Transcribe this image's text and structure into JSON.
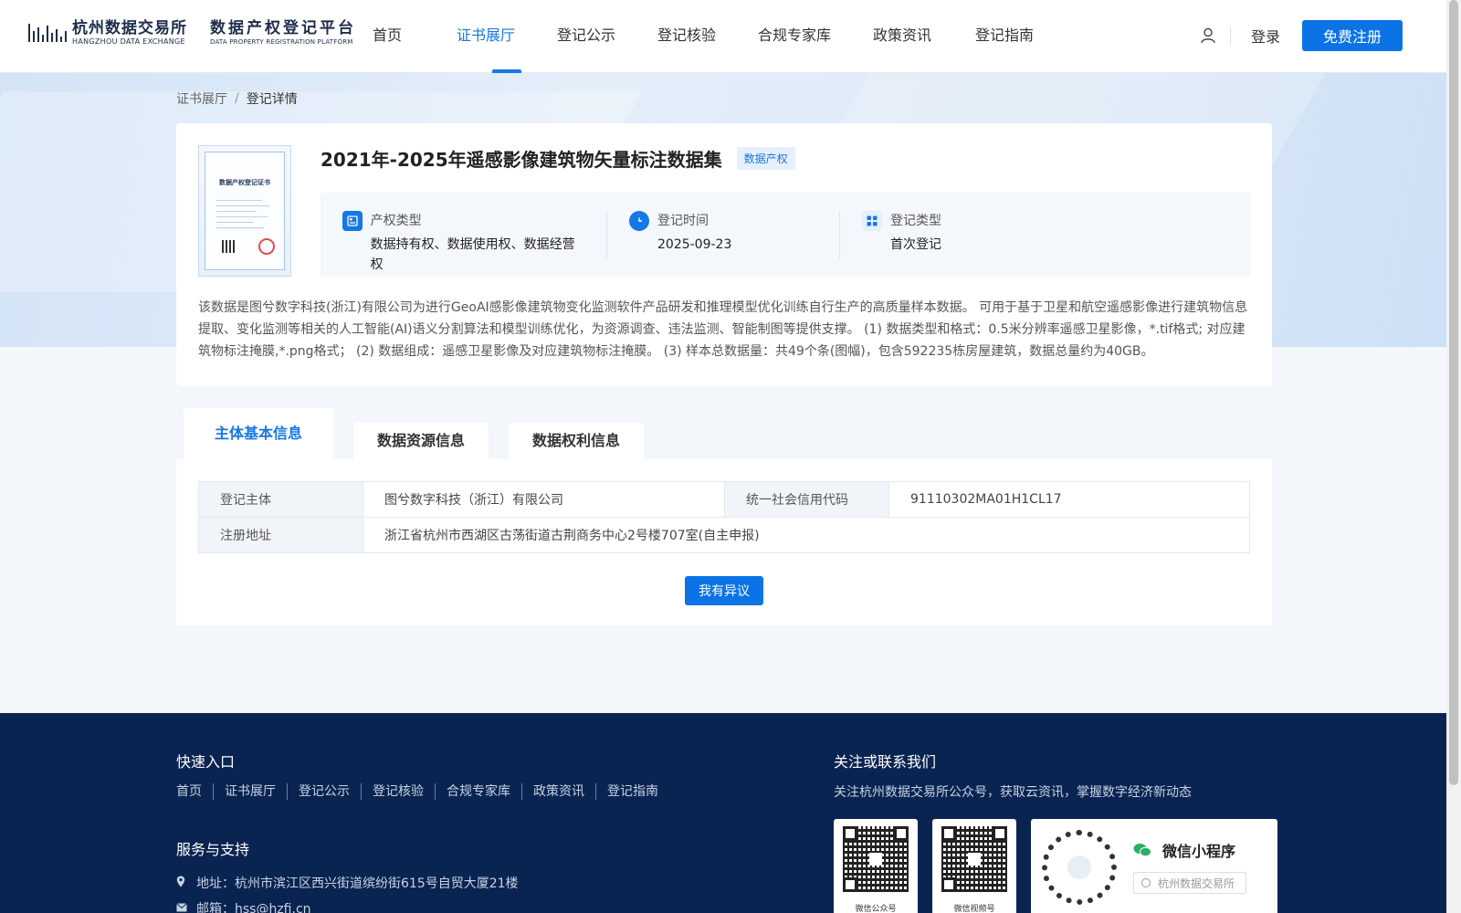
{
  "logo": {
    "org_cn": "杭州数据交易所",
    "org_en": "HANGZHOU DATA EXCHANGE",
    "platform_cn": "数据产权登记平台",
    "platform_en": "DATA PROPERTY REGISTRATION PLATFORM"
  },
  "nav": {
    "items": [
      {
        "label": "首页"
      },
      {
        "label": "证书展厅"
      },
      {
        "label": "登记公示"
      },
      {
        "label": "登记核验"
      },
      {
        "label": "合规专家库"
      },
      {
        "label": "政策资讯"
      },
      {
        "label": "登记指南"
      }
    ],
    "active_index": 1
  },
  "user": {
    "login_label": "登录",
    "register_label": "免费注册"
  },
  "breadcrumb": {
    "parent": "证书展厅",
    "separator": "/",
    "current": "登记详情"
  },
  "detail": {
    "title": "2021年-2025年遥感影像建筑物矢量标注数据集",
    "tag": "数据产权",
    "cert_title": "数据产权登记证书",
    "info": [
      {
        "label": "产权类型",
        "value": "数据持有权、数据使用权、数据经营权",
        "icon": "document-icon"
      },
      {
        "label": "登记时间",
        "value": "2025-09-23",
        "icon": "clock-icon"
      },
      {
        "label": "登记类型",
        "value": "首次登记",
        "icon": "grid-icon"
      }
    ],
    "description": "该数据是图兮数字科技(浙江)有限公司为进行GeoAI感影像建筑物变化监测软件产品研发和推理模型优化训练自行生产的高质量样本数据。 可用于基于卫星和航空遥感影像进行建筑物信息提取、变化监测等相关的人工智能(AI)语义分割算法和模型训练优化，为资源调查、违法监测、智能制图等提供支撑。 (1) 数据类型和格式：0.5米分辨率遥感卫星影像，*.tif格式; 对应建筑物标注掩膜,*.png格式； (2) 数据组成：遥感卫星影像及对应建筑物标注掩膜。 (3) 样本总数据量：共49个条(图幅)，包含592235栋房屋建筑，数据总量约为40GB。"
  },
  "tabs": {
    "items": [
      {
        "label": "主体基本信息"
      },
      {
        "label": "数据资源信息"
      },
      {
        "label": "数据权利信息"
      }
    ],
    "active_index": 0
  },
  "subject": {
    "rows": [
      {
        "k1": "登记主体",
        "v1": "图兮数字科技（浙江）有限公司",
        "k2": "统一社会信用代码",
        "v2": "91110302MA01H1CL17"
      },
      {
        "k1": "注册地址",
        "v1": "浙江省杭州市西湖区古荡街道古荆商务中心2号楼707室(自主申报)"
      }
    ],
    "objection_label": "我有异议"
  },
  "footer": {
    "quick_title": "快速入口",
    "quick_links": [
      "首页",
      "证书展厅",
      "登记公示",
      "登记核验",
      "合规专家库",
      "政策资讯",
      "登记指南"
    ],
    "service_title": "服务与支持",
    "address": "地址：杭州市滨江区西兴街道缤纷街615号自贸大厦21楼",
    "email": "邮箱：hss@hzfi.cn",
    "follow_title": "关注或联系我们",
    "follow_text": "关注杭州数据交易所公众号，获取云资讯，掌握数字经济新动态",
    "qr1_label": "微信公众号",
    "qr2_label": "微信视频号",
    "mini_title": "微信小程序",
    "mini_search": "杭州数据交易所"
  },
  "colors": {
    "accent": "#1677e6",
    "footer_bg": "#0a2451"
  }
}
